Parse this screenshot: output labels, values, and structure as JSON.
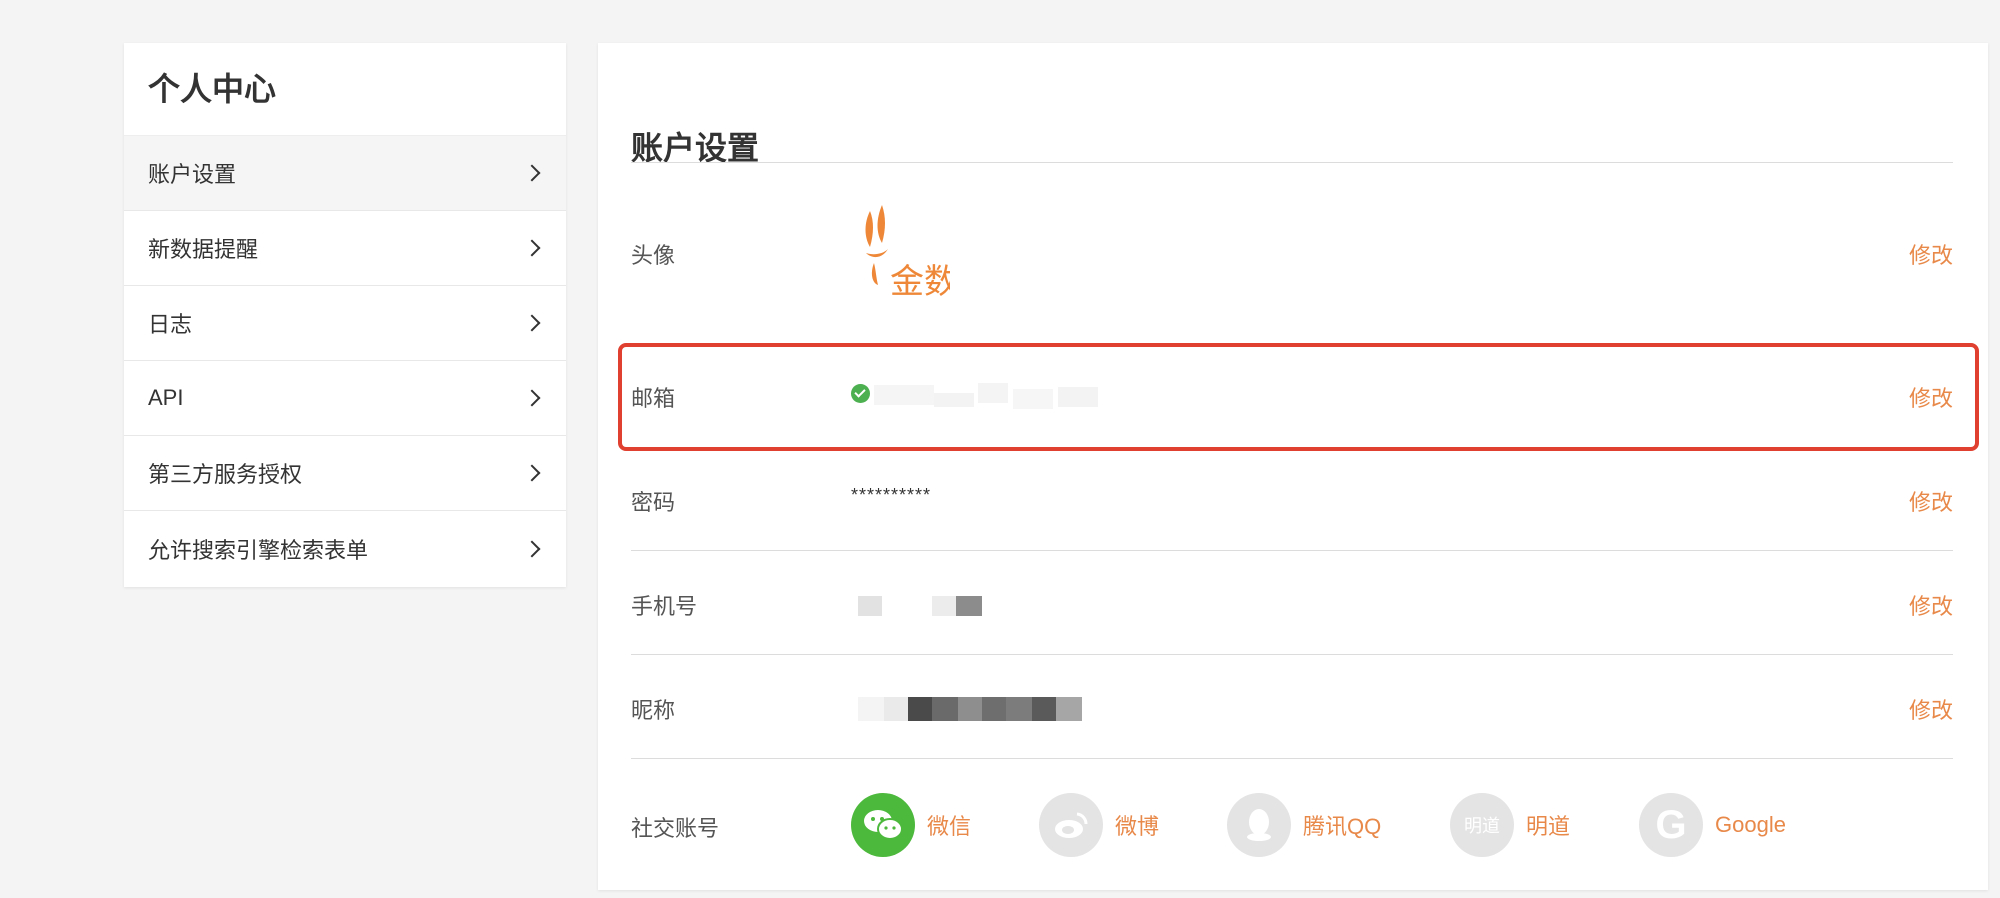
{
  "sidebar": {
    "title": "个人中心",
    "items": [
      {
        "label": "账户设置"
      },
      {
        "label": "新数据提醒"
      },
      {
        "label": "日志"
      },
      {
        "label": "API"
      },
      {
        "label": "第三方服务授权"
      },
      {
        "label": "允许搜索引擎检索表单"
      }
    ]
  },
  "panel": {
    "title": "账户设置",
    "rows": {
      "avatar": {
        "label": "头像",
        "edit": "修改",
        "logo_text": "金数据"
      },
      "email": {
        "label": "邮箱",
        "edit": "修改"
      },
      "password": {
        "label": "密码",
        "value": "**********",
        "edit": "修改"
      },
      "phone": {
        "label": "手机号",
        "edit": "修改"
      },
      "nickname": {
        "label": "昵称",
        "edit": "修改"
      },
      "social": {
        "label": "社交账号",
        "items": [
          {
            "name": "微信",
            "icon": "wechat-icon"
          },
          {
            "name": "微博",
            "icon": "weibo-icon"
          },
          {
            "name": "腾讯QQ",
            "icon": "qq-icon"
          },
          {
            "name": "明道",
            "icon": "mingdao-icon",
            "glyph": "明道"
          },
          {
            "name": "Google",
            "icon": "google-icon",
            "glyph": "G"
          }
        ]
      }
    }
  },
  "colors": {
    "accent": "#e8894a",
    "highlight_border": "#e04030",
    "wechat": "#4cb83c",
    "social_inactive": "#e4e4e4",
    "verified": "#4caf50"
  }
}
